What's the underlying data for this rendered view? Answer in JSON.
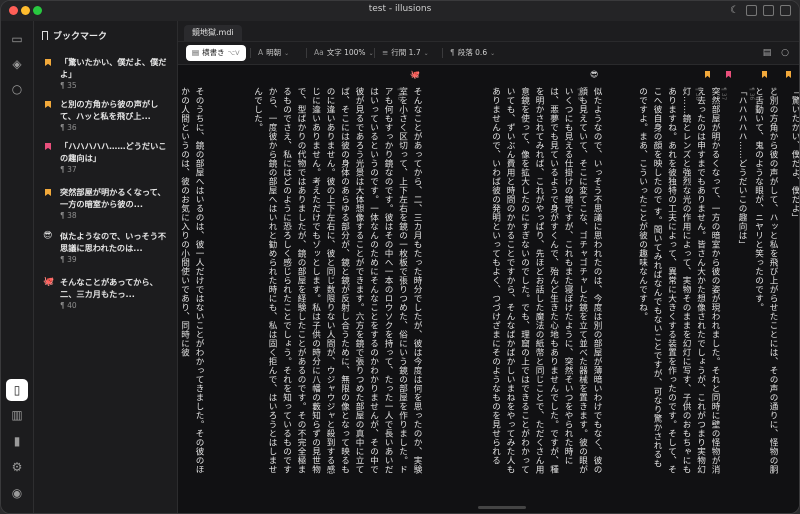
{
  "window": {
    "title": "test - illusions"
  },
  "sidebar": {
    "title": "ブックマーク",
    "items": [
      {
        "text": "「驚いたかい、僕だよ、僕だよ」",
        "para": "¶ 35",
        "icon": "flag",
        "color": "#f2a93b"
      },
      {
        "text": "と別の方角から彼の声がして、ハッと私を飛び上...",
        "para": "¶ 36",
        "icon": "flag",
        "color": "#f2a93b"
      },
      {
        "text": "「ハハハハハ……どうだいこの趣向は」",
        "para": "¶ 37",
        "icon": "flag",
        "color": "#e94f7c"
      },
      {
        "text": "突然部屋が明かるくなって、一方の暗室から彼の...",
        "para": "¶ 38",
        "icon": "flag",
        "color": "#f2a93b"
      },
      {
        "text": "似たようなので、いっそう不思議に思われたのは...",
        "para": "¶ 39",
        "icon": "emoji",
        "color": "#f5c542"
      },
      {
        "text": "そんなことがあってから、二、三カ月もたっ...",
        "para": "¶ 40",
        "icon": "emoji",
        "color": "#d9534f"
      }
    ]
  },
  "editor": {
    "tab": "鏡地獄.mdi",
    "toolbar": {
      "orientation": "横書き",
      "orientation_shortcut": "⌥V",
      "font": "明朝",
      "size": "文字 100%",
      "line_height": "行間 1.7",
      "para_spacing": "段落 0.6"
    },
    "columns": [
      "「驚いたかい、僕だよ、僕だよ」",
      "と別の方角から彼の声がして、ハッと私を飛び上がらせたことには、その声の通りに、怪物の胴と舌動いて、鬼のような眼が、ニヤリと笑ったのです。",
      "「ハハハハハ……どうだいこの趣向は」",
      "突然部屋が明かるくなって、一方の暗室から彼の姿が現われました。それと同時に壁の怪物が消え去ったのは申すまでもありません。皆さん大かた想像されたでしょうが、これがつまり実物幻灯……鏡とレンズと強烈な光の作用によって、実物そのままを幻灯に写す、子供のおもちゃにもありますね。あれを彼独特の工夫によって、異常に大きくする装置を作ったのです。そして、そこへ彼自身の顔を映したので す。聞いてみればなんでもないことですが、可なり驚かされるものですよ。まあ、こういったことが彼の趣味なんですね。",
      "似たようなので、いっそう不思議に思われたのは、今度は別の部屋が薄暗いわけでもなく、彼の顔も見えていて、そこに変てこな、ゴチャゴチャした鏡を立て並べた器械を置きます。彼の眼がいくつにも見える仕掛けの鏡ですが、これもまた寝ぼけたように、突然そいつをやられた時には、悪夢でも見ているようで身がすくんで、殆んど生きた心地もありませんでした。ですが、種を明かされてみれば、これがやっぱり、先ほどお話した魔法の紙幣と同じことで、ただくさん用意鏡を使って、像を拡大したのにすぎないのでした。でも、理窟の上ではできることがわかっていても、ずいぶん費用と時間のかかることですから、そんなばかばかしいまねをやってみた人もありませんので、いわば彼の発明といってもよく、つづけざまにそのようなものを見せられると、なにかこう、彼が恐ろしい魔物のようにさえ思われてくるのでありました。",
      "そんなことがあってから、二、三カ月もたった時分でしたが、彼は今度は何を思ったのか、実験室を小さく区切って、上下左右を鏡の一枚板で張りつめた、俗にいう鏡の部屋を作りました。ドアも何もすっかり鏡なのです。彼はその中へ一本のロウソクを持って、たった一人で長いあいだはいっているというのです。一体なんのためにそんなことをするのかわかりませんが、その中で彼が見るであろう光景は大体想像することができます。六方を鏡で張りつめた部屋の真中に立てば、そこには彼の身体のあらゆる部分が、鏡と鏡が反射し合うために、無限の像となって映るものに違いありません。彼の上下左右に、彼と同じ数限りない人間が、ウジャウジャと殺到する感じに違いありません。考えただけでもゾッとします。私は子供の時分に八幡の藪知らずの見世物で、型ばかりの代物ではありましたが、鏡の部屋を経験したことがあるのです。その不完全極まるものでさえ、私にはどのように恐ろしく感じられたことでしょう。それを知っているものですから、一度彼から鏡の部屋へはいれと勧められた時にも、私は固く拒んで、はいろうとはしませんでした。",
      "そのうちに、鏡の部屋へはいるのは、彼一人だけではないことがわかってきました。その彼のほかの人間というのは、彼のお気に入りの小間使いであり、同時に彼"
    ],
    "para_numbers": [
      "¶ 35",
      "¶ 36",
      "¶ 37",
      "¶ 38",
      "¶ 39",
      "¶ 40"
    ]
  }
}
